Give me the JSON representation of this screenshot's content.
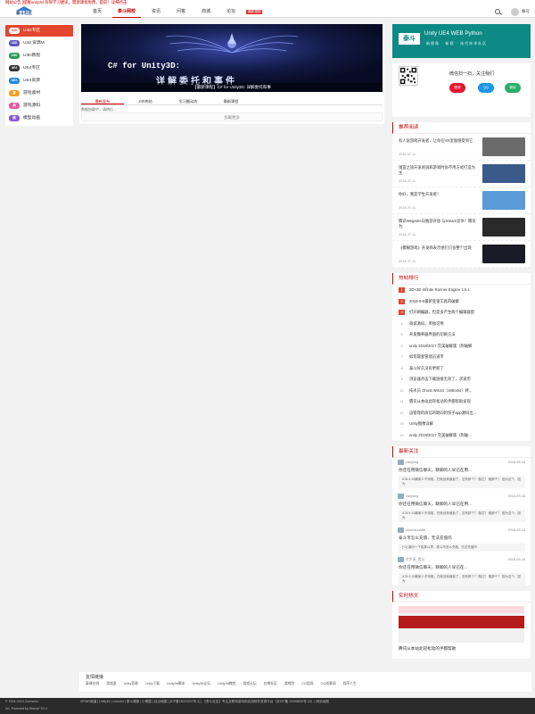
{
  "notice": "网站公告 [提醒unity3d 有限学习捷讯，需源课程免费，提前！详细点击",
  "logo": {
    "text": "泰斗社区"
  },
  "nav": [
    {
      "label": "首页",
      "active": false
    },
    {
      "label": "泰斗网校",
      "active": true
    },
    {
      "label": "资讯",
      "active": false
    },
    {
      "label": "问答",
      "active": false
    },
    {
      "label": "商城",
      "active": false
    },
    {
      "label": "论坛",
      "active": false
    }
  ],
  "nav_badge": "最新课程",
  "user": {
    "name": "帐号"
  },
  "sidebar": [
    {
      "label": "U3D专区",
      "icon": "U3D",
      "color": "#e3452e",
      "active": true
    },
    {
      "label": "U3d 资源M",
      "icon": "U3D",
      "color": "#5a57c8",
      "active": false
    },
    {
      "label": "U3D教程",
      "icon": "U3D",
      "color": "#2c9b5a",
      "active": false
    },
    {
      "label": "UE4专区",
      "icon": "UE4",
      "color": "#333333",
      "active": false
    },
    {
      "label": "UE4资源",
      "icon": "UE4",
      "color": "#1e88e5",
      "active": false
    },
    {
      "label": "游戏素材",
      "icon": "游",
      "color": "#f0a020",
      "active": false
    },
    {
      "label": "游戏源码",
      "icon": "源",
      "color": "#e05a9c",
      "active": false
    },
    {
      "label": "模型动画",
      "icon": "模",
      "color": "#8a5ad8",
      "active": false
    }
  ],
  "banner": {
    "line1": "C# for Unity3D:",
    "line2": "详解委托和事件",
    "caption": "【最新课程】C# for Unity3D: 详解委托和事"
  },
  "tabs": [
    "最新发布",
    "24h热帖",
    "学习圈动态",
    "最新课程"
  ],
  "loading": "数据加载中，请稍后...",
  "load_more": "加载更多",
  "promo": {
    "title": "Unity UE4 WEB Python",
    "subtitle": "新视角 · 新视 · 技代技术社区",
    "logo": "泰斗"
  },
  "follow": {
    "text": "微信扫一扫，关注我们",
    "social": [
      {
        "name": "weibo-icon",
        "label": "微博",
        "color": "#e6162d"
      },
      {
        "name": "qq-icon",
        "label": "QQ",
        "color": "#1e96e8"
      },
      {
        "name": "wechat-icon",
        "label": "微信",
        "color": "#2aae67"
      }
    ]
  },
  "recommend": {
    "title": "推荐阅读",
    "items": [
      {
        "title": "有人说游戏开发者，让你在VR里面感受到它",
        "date": "2018-07-11",
        "img": "#6b6b6b"
      },
      {
        "title": "镜造之途开发闲说和游戏时尚不用方式打造为主",
        "date": "2018-07-11",
        "img": "#3a5a8a"
      },
      {
        "title": "你好，我是学生开发者！",
        "date": "2018-07-11",
        "img": "#5a9bd8"
      },
      {
        "title": "腾讯Wegame向独游开放 与Steam竞争？腾讯为",
        "date": "2018-07-11",
        "img": "#2a2a2a"
      },
      {
        "title": "《模糊游戏》开发商表示他们只会整个出现",
        "date": "2018-07-11",
        "img": "#1a1a28"
      }
    ]
  },
  "hot": {
    "title": "热帖排行",
    "items": [
      {
        "rank": "1",
        "text": "2D+3D Infinite Runner Engine 1.5.1"
      },
      {
        "rank": "2",
        "text": "2018-9-5最新变速工具的破解"
      },
      {
        "rank": "3",
        "text": "打开网编器，但是多产生两个编辑器窗"
      },
      {
        "rank": "4",
        "text": "商城源码，单独可用"
      },
      {
        "rank": "5",
        "text": "开发魏养器界面的切换方法"
      },
      {
        "rank": "6",
        "text": "unity 2018/2017 完美破解版（附破解"
      },
      {
        "rank": "7",
        "text": "如何取套管理员道币"
      },
      {
        "rank": "8",
        "text": "泰斗好久没有更新了"
      },
      {
        "rank": "9",
        "text": "浏览器点击下载链接无效了，求道币"
      },
      {
        "rank": "10",
        "text": "技术员 Ghost Win10（x86/x64）终..."
      },
      {
        "rank": "11",
        "text": "腾讯从本站此轻松动的手都帮助发现"
      },
      {
        "rank": "12",
        "text": "运管理的商信的期间的快子app源码出..."
      },
      {
        "rank": "13",
        "text": "Unity图像详解"
      },
      {
        "rank": "14",
        "text": "unity 2018/2017 完美破解版（附破..."
      }
    ]
  },
  "follow_latest": {
    "title": "最新关注",
    "items": [
      {
        "user": "zanjiang",
        "date": "2018-09-18",
        "title": "你还在用微信聊天，聊卿的人早已在用...",
        "quote": "A78-9-18最家人不采取，在就创到道板了，这有那个？ 融达？ 融那个？ 因为这个，因为"
      },
      {
        "user": "zanjiang",
        "date": "2018-09-18",
        "title": "你还在用微信聊天，聊卿的人早已在用...",
        "quote": "A78-9-18最家人不采取，在就创到道板了，这有那个？ 融达？ 融那个？ 因为这个，因为"
      },
      {
        "user": "moonsun888",
        "date": "2018-09-18",
        "title": "泰斗币怎么充值，无法充值吗",
        "quote": "[+1] 道问一下各泰斗界，泰斗币怎么充值，无法充值吗"
      },
      {
        "user": "步步高_我记",
        "date": "2018-09-18",
        "title": "你还在用微信聊天，聊卿的人早已在...",
        "quote": "A78-9-18最家人不采取，在就创到道板了，这有那个？ 融达？ 融那个？ 因为这个，因为"
      }
    ]
  },
  "realtime": {
    "title": "实时热文",
    "item": "腾讯从本站此轻松动的手都帮助"
  },
  "links": {
    "title": "友情链接",
    "items": [
      "泰课在线",
      "游戏蛮",
      "Unity资源",
      "Unity下载",
      "Unity3d脚本",
      "Unity3d论坛",
      "Unity3d教程",
      "游戏论坛",
      "在哪社区",
      "游戏院",
      "CG组场",
      "CG创意网",
      "程序人生"
    ]
  },
  "footer": {
    "left1": "© 2001-2013 Comsenz",
    "left2": "Inc. Powered by Discuz! X3.4",
    "links": "VR/AR频道 | Unity3d | Unreal4 | 泰斗课程 | 小黑屋 | 站点地图 | [ICP备18023207号-1] | 【泰斗社区】专注互联网游戏和应用软件资源平台（京ICP备 13008832号-15）| 网站地图"
  }
}
